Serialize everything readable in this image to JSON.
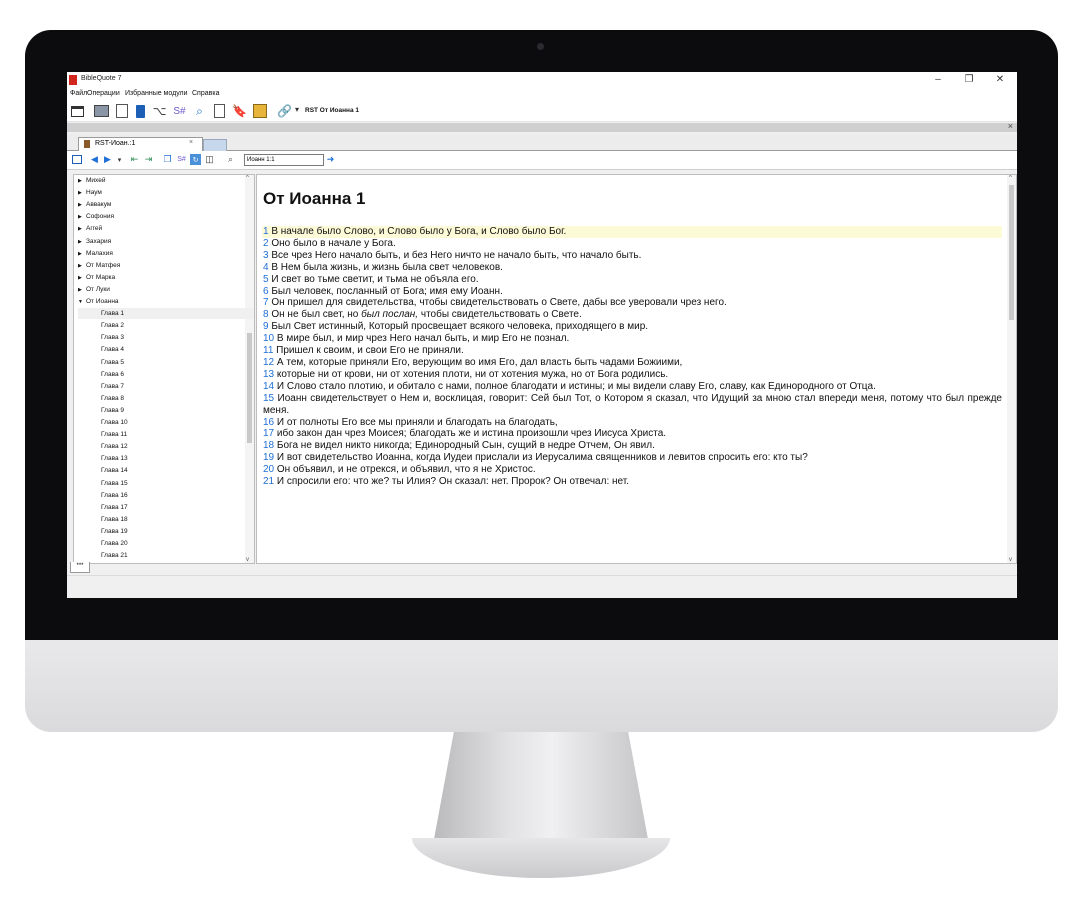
{
  "window": {
    "title": "BibleQuote 7",
    "min": "–",
    "max": "❐",
    "close": "✕"
  },
  "menu": [
    "Файл",
    "Операции",
    "Избранные модули",
    "Справка"
  ],
  "toolbar": {
    "module_label": "RST От Иоанна 1",
    "dropdown": "▾"
  },
  "band": {
    "close": "×"
  },
  "tabs": {
    "active_label": "RST-Иоан.:1",
    "active_close": "×"
  },
  "nav": {
    "address": "Иоанн 1:1",
    "go": "➜"
  },
  "tree": {
    "books": [
      {
        "label": "Михей",
        "expanded": false
      },
      {
        "label": "Наум",
        "expanded": false
      },
      {
        "label": "Аввакум",
        "expanded": false
      },
      {
        "label": "Софония",
        "expanded": false
      },
      {
        "label": "Аггей",
        "expanded": false
      },
      {
        "label": "Захария",
        "expanded": false
      },
      {
        "label": "Малахия",
        "expanded": false
      },
      {
        "label": "От Матфея",
        "expanded": false
      },
      {
        "label": "От Марка",
        "expanded": false
      },
      {
        "label": "От Луки",
        "expanded": false
      },
      {
        "label": "От Иоанна",
        "expanded": true
      }
    ],
    "chapters": [
      "Глава 1",
      "Глава 2",
      "Глава 3",
      "Глава 4",
      "Глава 5",
      "Глава 6",
      "Глава 7",
      "Глава 8",
      "Глава 9",
      "Глава 10",
      "Глава 11",
      "Глава 12",
      "Глава 13",
      "Глава 14",
      "Глава 15",
      "Глава 16",
      "Глава 17",
      "Глава 18",
      "Глава 19",
      "Глава 20",
      "Глава 21"
    ],
    "selected_chapter": "Глава 1"
  },
  "content": {
    "chapter_title": "От Иоанна 1",
    "verses": [
      {
        "n": "1",
        "text": " В начале было Слово, и Слово было у Бога, и Слово было Бог."
      },
      {
        "n": "2",
        "text": " Оно было в начале у Бога."
      },
      {
        "n": "3",
        "text": " Все чрез Него начало быть, и без Него ничто не начало быть, что начало быть."
      },
      {
        "n": "4",
        "text": " В Нем была жизнь, и жизнь была свет человеков."
      },
      {
        "n": "5",
        "text": " И свет во тьме светит, и тьма не объяла его."
      },
      {
        "n": "6",
        "text": " Был человек, посланный от Бога; имя ему Иоанн."
      },
      {
        "n": "7",
        "text": " Он пришел для свидетельства, чтобы свидетельствовать о Свете, дабы все уверовали чрез него."
      },
      {
        "n": "8",
        "text": " Он не был свет, но ",
        "italic": "был послан,",
        "after": " чтобы свидетельствовать о Свете."
      },
      {
        "n": "9",
        "text": " Был Свет истинный, Который просвещает всякого человека, приходящего в мир."
      },
      {
        "n": "10",
        "text": " В мире был, и мир чрез Него начал быть, и мир Его не познал."
      },
      {
        "n": "11",
        "text": " Пришел к своим, и свои Его не приняли."
      },
      {
        "n": "12",
        "text": " А тем, которые приняли Его, верующим во имя Его, дал власть быть чадами Божиими,"
      },
      {
        "n": "13",
        "text": " которые ни от крови, ни от хотения плоти, ни от хотения мужа, но от Бога родились."
      },
      {
        "n": "14",
        "text": " И Слово стало плотию, и обитало с нами, полное благодати и истины; и мы видели славу Его, славу, как Единородного от Отца."
      },
      {
        "n": "15",
        "text": " Иоанн свидетельствует о Нем и, восклицая, говорит: Сей был Тот, о Котором я сказал, что Идущий за мною стал впереди меня, потому что был прежде меня."
      },
      {
        "n": "16",
        "text": " И от полноты Его все мы приняли и благодать на благодать,"
      },
      {
        "n": "17",
        "text": " ибо закон дан чрез Моисея; благодать же и истина произошли чрез Иисуса Христа."
      },
      {
        "n": "18",
        "text": " Бога не видел никто никогда; Единородный Сын, сущий в недре Отчем, Он явил."
      },
      {
        "n": "19",
        "text": " И вот свидетельство Иоанна, когда Иудеи прислали из Иерусалима священников и левитов спросить его: кто ты?"
      },
      {
        "n": "20",
        "text": " Он объявил, и не отрекся, и объявил, что я не Христос."
      },
      {
        "n": "21",
        "text": " И спросили его: что же? ты Илия? Он сказал: нет. Пророк? Он отвечал: нет."
      }
    ]
  },
  "bottom_tab": "***",
  "colors": {
    "verse_number": "#1e6fd6",
    "highlight": "#fdfad8",
    "accent": "#d1261e"
  }
}
